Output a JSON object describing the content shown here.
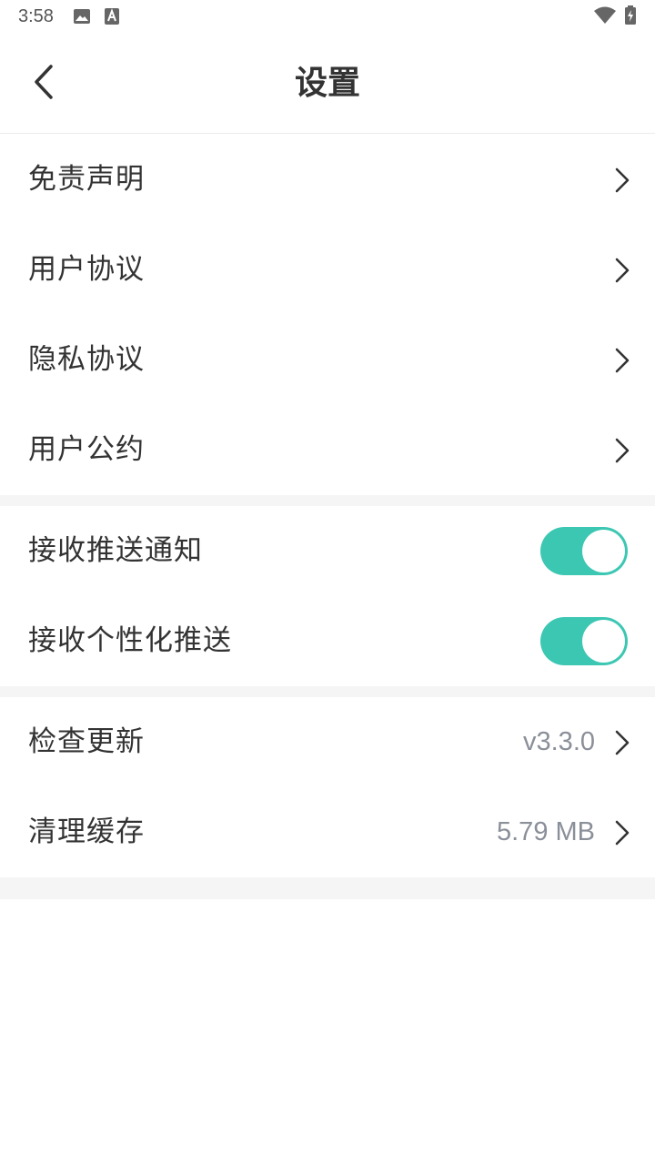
{
  "status_bar": {
    "time": "3:58",
    "icons": [
      "image-icon",
      "text-a-icon",
      "wifi-icon",
      "battery-charging-icon"
    ]
  },
  "header": {
    "title": "设置",
    "back_icon": "chevron-left-icon"
  },
  "sections": {
    "legal": {
      "items": [
        {
          "label": "免责声明"
        },
        {
          "label": "用户协议"
        },
        {
          "label": "隐私协议"
        },
        {
          "label": "用户公约"
        }
      ]
    },
    "notifications": {
      "items": [
        {
          "label": "接收推送通知",
          "enabled": true
        },
        {
          "label": "接收个性化推送",
          "enabled": true
        }
      ]
    },
    "app": {
      "items": [
        {
          "label": "检查更新",
          "value": "v3.3.0"
        },
        {
          "label": "清理缓存",
          "value": "5.79 MB"
        }
      ]
    }
  },
  "colors": {
    "toggle_on": "#3cc7b3",
    "divider": "#f5f5f5",
    "value_text": "#8a8f99"
  }
}
